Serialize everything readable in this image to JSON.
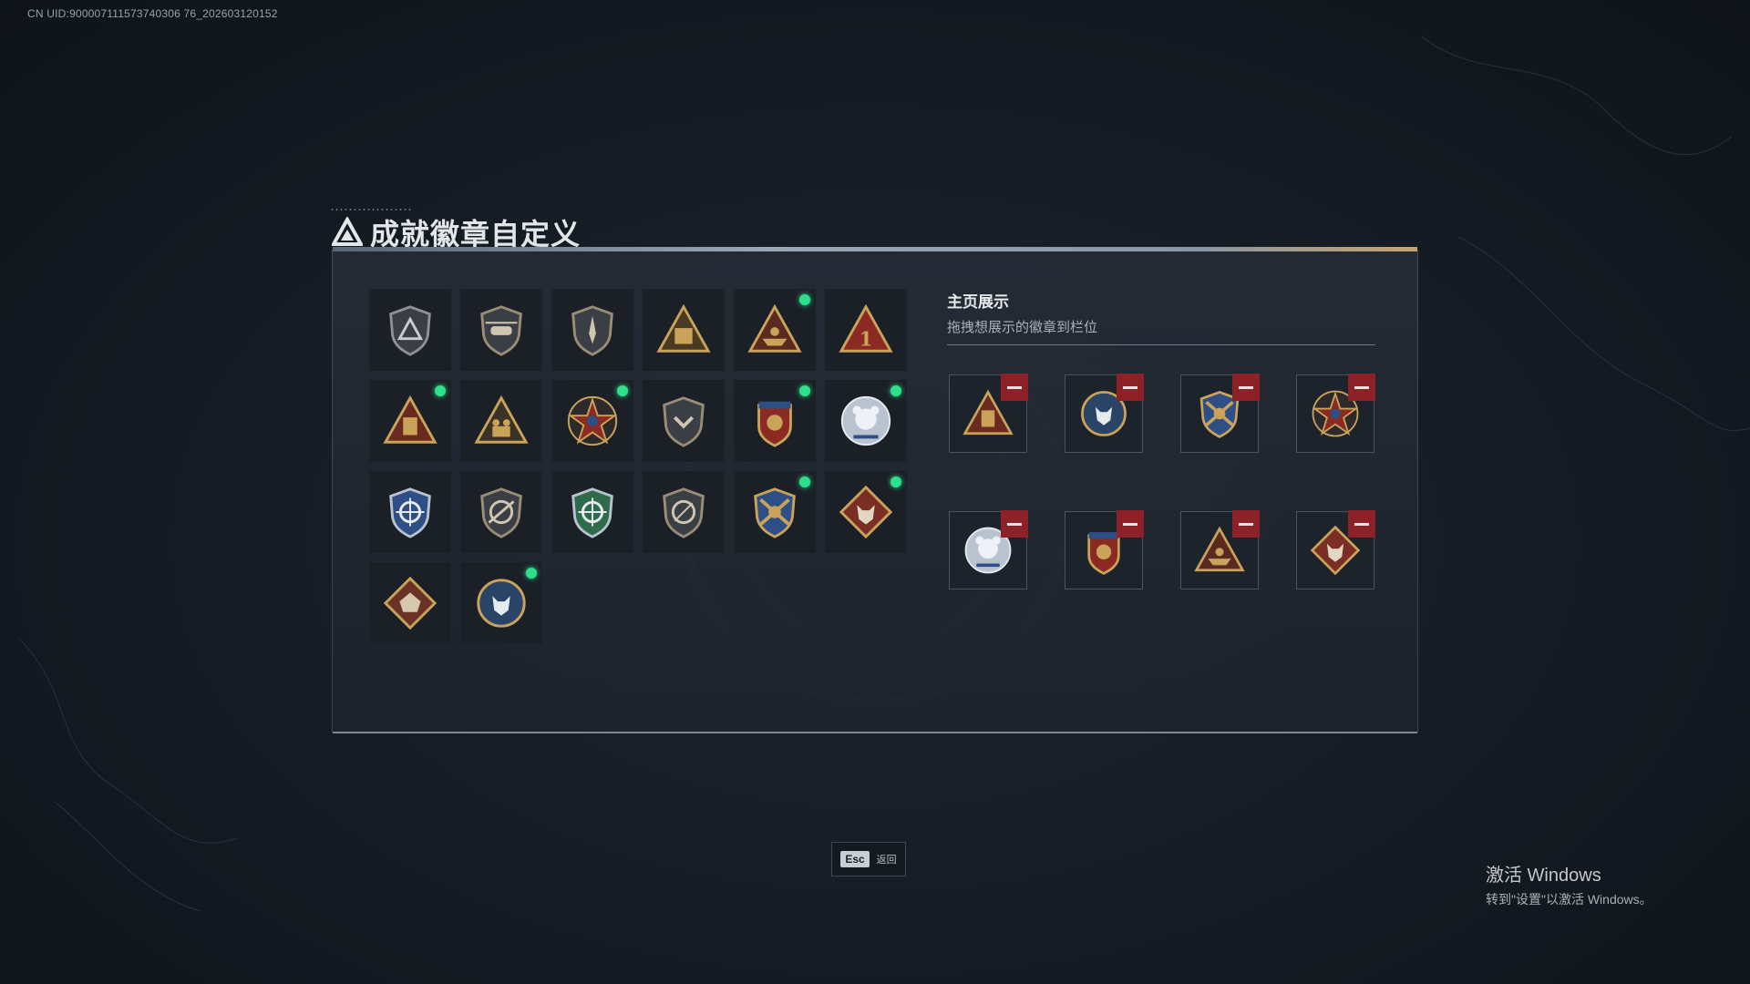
{
  "uid": "CN UID:900007111573740306 76_202603120152",
  "title": "成就徽章自定义",
  "colors": {
    "accent_dot": "#2fe08a",
    "remove": "#8c2228",
    "gold": "#c9a35a"
  },
  "badges": [
    {
      "icon": "triangle-shield-icon",
      "new": false
    },
    {
      "icon": "helicopter-shield-icon",
      "new": false
    },
    {
      "icon": "dagger-shield-icon",
      "new": false
    },
    {
      "icon": "ammo-crate-icon",
      "new": false
    },
    {
      "icon": "boat-triangle-icon",
      "new": true
    },
    {
      "icon": "number-one-triangle-icon",
      "new": false
    },
    {
      "icon": "container-triangle-icon",
      "new": true
    },
    {
      "icon": "soldiers-triangle-icon",
      "new": false
    },
    {
      "icon": "star-emblem-icon",
      "new": true
    },
    {
      "icon": "chevron-shield-icon",
      "new": false
    },
    {
      "icon": "crest-emblem-icon",
      "new": true
    },
    {
      "icon": "bear-emblem-icon",
      "new": true
    },
    {
      "icon": "crosshair-blue-shield-icon",
      "new": false
    },
    {
      "icon": "rifle-shield-icon",
      "new": false
    },
    {
      "icon": "crosshair-green-shield-icon",
      "new": false
    },
    {
      "icon": "sniper-shield-icon",
      "new": false
    },
    {
      "icon": "crossed-rifles-emblem-icon",
      "new": true
    },
    {
      "icon": "wolf-diamond-icon",
      "new": true
    },
    {
      "icon": "dragon-diamond-icon",
      "new": false
    },
    {
      "icon": "wolf-round-icon",
      "new": true
    }
  ],
  "showcase": {
    "title": "主页展示",
    "subtitle": "拖拽想展示的徽章到栏位",
    "slots": [
      {
        "icon": "container-triangle-icon"
      },
      {
        "icon": "wolf-round-icon"
      },
      {
        "icon": "crossed-rifles-emblem-icon"
      },
      {
        "icon": "star-emblem-icon"
      },
      {
        "icon": "bear-emblem-icon"
      },
      {
        "icon": "crest-emblem-icon"
      },
      {
        "icon": "boat-triangle-icon"
      },
      {
        "icon": "wolf-diamond-icon"
      }
    ]
  },
  "footer": {
    "esc_key": "Esc",
    "esc_label": "返回"
  },
  "watermark": {
    "title": "激活 Windows",
    "subtitle": "转到\"设置\"以激活 Windows。"
  }
}
